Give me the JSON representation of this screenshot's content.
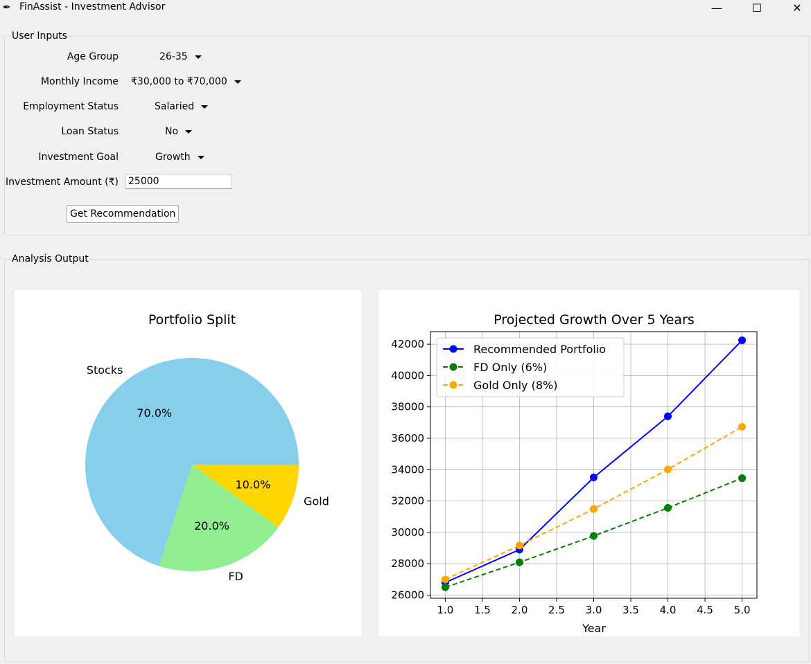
{
  "window": {
    "title": "FinAssist - Investment Advisor",
    "icon": "feather-icon",
    "controls": [
      "minimize",
      "maximize",
      "close"
    ]
  },
  "inputs": {
    "legend": "User Inputs",
    "age_group": {
      "label": "Age Group",
      "value": "26-35"
    },
    "monthly_income": {
      "label": "Monthly Income",
      "value": "₹30,000 to ₹70,000"
    },
    "employment_status": {
      "label": "Employment Status",
      "value": "Salaried"
    },
    "loan_status": {
      "label": "Loan Status",
      "value": "No"
    },
    "investment_goal": {
      "label": "Investment Goal",
      "value": "Growth"
    },
    "investment_amount": {
      "label": "Investment Amount (₹)",
      "value": "25000"
    },
    "button_label": "Get Recommendation"
  },
  "output": {
    "legend": "Analysis Output"
  },
  "chart_data": [
    {
      "type": "pie",
      "title": "Portfolio Split",
      "categories": [
        "Stocks",
        "FD",
        "Gold"
      ],
      "values": [
        70.0,
        20.0,
        10.0
      ],
      "labels_pct": [
        "70.0%",
        "20.0%",
        "10.0%"
      ],
      "colors": [
        "#87ceeb",
        "#90ee90",
        "#ffd700"
      ]
    },
    {
      "type": "line",
      "title": "Projected Growth Over 5 Years",
      "xlabel": "Year",
      "ylabel": "",
      "x": [
        1.0,
        2.0,
        3.0,
        4.0,
        5.0
      ],
      "xticks": [
        "1.0",
        "1.5",
        "2.0",
        "2.5",
        "3.0",
        "3.5",
        "4.0",
        "4.5",
        "5.0"
      ],
      "yticks": [
        "26000",
        "28000",
        "30000",
        "32000",
        "34000",
        "36000",
        "38000",
        "40000",
        "42000"
      ],
      "xlim": [
        0.8,
        5.2
      ],
      "ylim": [
        25800,
        42800
      ],
      "grid": true,
      "legend_position": "upper-left",
      "series": [
        {
          "name": "Recommended Portfolio",
          "color": "#0000ff",
          "dashed": false,
          "values": [
            26800,
            28900,
            33500,
            37400,
            42250
          ]
        },
        {
          "name": "FD Only (6%)",
          "color": "#008000",
          "dashed": true,
          "values": [
            26500,
            28090,
            29775,
            31562,
            33455
          ]
        },
        {
          "name": "Gold Only (8%)",
          "color": "#ffa500",
          "dashed": true,
          "values": [
            27000,
            29160,
            31493,
            34012,
            36733
          ]
        }
      ]
    }
  ]
}
